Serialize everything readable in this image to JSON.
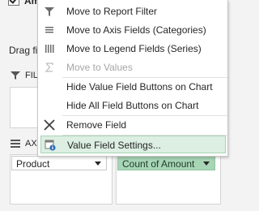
{
  "pane": {
    "field_name": "Am",
    "field_checked": true,
    "drag_hint": "Drag fi",
    "filters_label": "FIL",
    "axis_label": "AX",
    "axis_field": "Product",
    "values_field": "Count of Amount"
  },
  "menu": {
    "items": [
      {
        "label": "Move to Report Filter",
        "icon": "filter-icon",
        "enabled": true
      },
      {
        "label": "Move to Axis Fields (Categories)",
        "icon": "rows-icon",
        "enabled": true
      },
      {
        "label": "Move to Legend Fields (Series)",
        "icon": "columns-icon",
        "enabled": true
      },
      {
        "label": "Move to Values",
        "icon": "sigma-icon",
        "enabled": false
      },
      {
        "label": "Hide Value Field Buttons on Chart",
        "icon": "",
        "enabled": true
      },
      {
        "label": "Hide All Field Buttons on Chart",
        "icon": "",
        "enabled": true
      },
      {
        "label": "Remove Field",
        "icon": "remove-icon",
        "enabled": true
      },
      {
        "label": "Value Field Settings...",
        "icon": "field-settings-icon",
        "enabled": true,
        "highlighted": true
      }
    ]
  },
  "colors": {
    "highlight_bg": "#dcefe2",
    "highlight_border": "#a9d3b5",
    "values_chip": "#a8d5b6"
  }
}
